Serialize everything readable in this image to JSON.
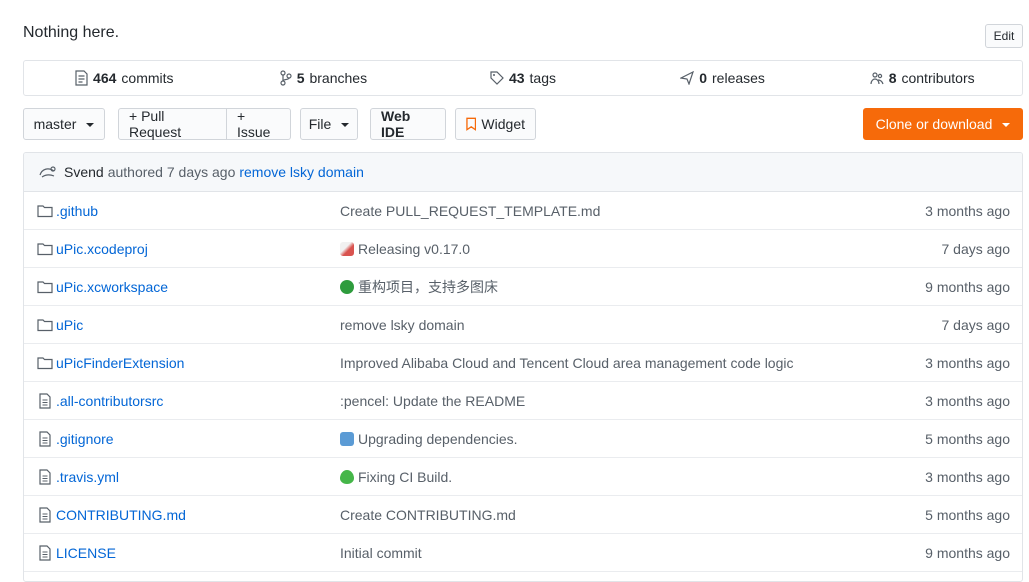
{
  "repo": {
    "description": "Nothing here.",
    "edit_label": "Edit"
  },
  "summary": {
    "commits_count": "464",
    "commits_label": "commits",
    "branches_count": "5",
    "branches_label": "branches",
    "tags_count": "43",
    "tags_label": "tags",
    "releases_count": "0",
    "releases_label": "releases",
    "contributors_count": "8",
    "contributors_label": "contributors"
  },
  "toolbar": {
    "branch": "master",
    "pull_request": "+ Pull Request",
    "issue": "+ Issue",
    "file": "File",
    "web_ide": "Web IDE",
    "widget": "Widget",
    "clone": "Clone or download"
  },
  "latest_commit": {
    "author": "Svend",
    "authored_text": "authored 7 days ago",
    "message": "remove lsky domain"
  },
  "files": [
    {
      "type": "dir",
      "name": ".github",
      "message": "Create PULL_REQUEST_TEMPLATE.md",
      "emoji": "",
      "age": "3 months ago"
    },
    {
      "type": "dir",
      "name": "uPic.xcodeproj",
      "message": "Releasing v0.17.0",
      "emoji": "rocket",
      "age": "7 days ago"
    },
    {
      "type": "dir",
      "name": "uPic.xcworkspace",
      "message": "重构项目，支持多图床",
      "emoji": "recycle",
      "age": "9 months ago"
    },
    {
      "type": "dir",
      "name": "uPic",
      "message": "remove lsky domain",
      "emoji": "",
      "age": "7 days ago"
    },
    {
      "type": "dir",
      "name": "uPicFinderExtension",
      "message": "Improved Alibaba Cloud and Tencent Cloud area management code logic",
      "emoji": "",
      "age": "3 months ago"
    },
    {
      "type": "file",
      "name": ".all-contributorsrc",
      "message": ":pencel: Update the README",
      "emoji": "",
      "age": "3 months ago"
    },
    {
      "type": "file",
      "name": ".gitignore",
      "message": "Upgrading dependencies.",
      "emoji": "arrow_up",
      "age": "5 months ago"
    },
    {
      "type": "file",
      "name": ".travis.yml",
      "message": "Fixing CI Build.",
      "emoji": "green_heart",
      "age": "3 months ago"
    },
    {
      "type": "file",
      "name": "CONTRIBUTING.md",
      "message": "Create CONTRIBUTING.md",
      "emoji": "",
      "age": "5 months ago"
    },
    {
      "type": "file",
      "name": "LICENSE",
      "message": "Initial commit",
      "emoji": "",
      "age": "9 months ago"
    }
  ],
  "colors": {
    "link": "#0366d6",
    "clone_button": "#f66a0a",
    "muted": "#586069"
  }
}
